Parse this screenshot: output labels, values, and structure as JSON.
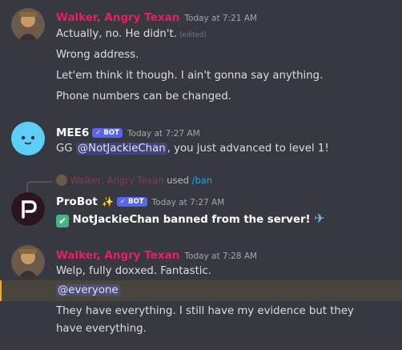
{
  "colors": {
    "background": "#36393f",
    "walker_name": "#e91e63",
    "mee6_name": "#ffffff",
    "probot_name": "#ffffff",
    "bot_tag": "#5865f2",
    "mention_bg": "#3c4270",
    "highlight": "#49443c",
    "command": "#00aff4"
  },
  "messages": [
    {
      "author": "Walker, Angry Texan",
      "timestamp": "Today at 7:21 AM",
      "lines": [
        "Actually, no. He didn't.",
        "Wrong address.",
        "Let'em think it though. I ain't gonna say anything.",
        "Phone numbers can be changed."
      ],
      "edited_label": "(edited)"
    },
    {
      "author": "MEE6",
      "bot_tag": "BOT",
      "timestamp": "Today at 7:27 AM",
      "text_before": "GG ",
      "mention": "@NotJackieChan",
      "text_after": ", you just advanced to level 1!"
    },
    {
      "reply_author": "Walker, Angry Texan",
      "reply_used": "used",
      "reply_command": "/ban",
      "author": "ProBot",
      "sparkle": "✨",
      "bot_tag": "BOT",
      "timestamp": "Today at 7:27 AM",
      "check": "✅",
      "text": "NotJackieChan banned from the server!",
      "plane": "✈️"
    },
    {
      "author": "Walker, Angry Texan",
      "timestamp": "Today at 7:28 AM",
      "line1": "Welp, fully doxxed. Fantastic.",
      "mention_everyone": "@everyone",
      "line3a": "They have everything. I still have my evidence but they",
      "line3b": "have everything."
    }
  ]
}
